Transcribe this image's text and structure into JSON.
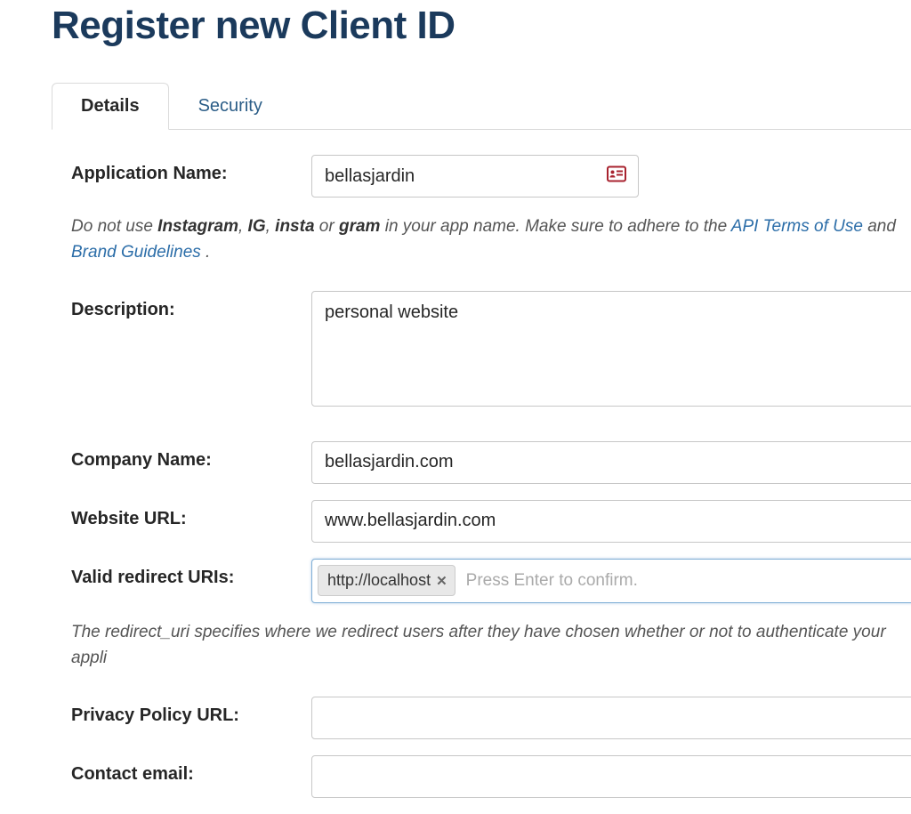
{
  "page_title": "Register new Client ID",
  "tabs": {
    "details": "Details",
    "security": "Security"
  },
  "labels": {
    "application_name": "Application Name:",
    "description": "Description:",
    "company_name": "Company Name:",
    "website_url": "Website URL:",
    "valid_redirect_uris": "Valid redirect URIs:",
    "privacy_policy_url": "Privacy Policy URL:",
    "contact_email": "Contact email:"
  },
  "values": {
    "application_name": "bellasjardin",
    "description": "personal website",
    "company_name": "bellasjardin.com",
    "website_url": "www.bellasjardin.com",
    "redirect_uri_tag": "http://localhost",
    "privacy_policy_url": "",
    "contact_email": ""
  },
  "placeholders": {
    "redirect_uris": "Press Enter to confirm."
  },
  "help": {
    "app_name_prefix": "Do not use ",
    "app_name_bold1": "Instagram",
    "app_name_sep1": ", ",
    "app_name_bold2": "IG",
    "app_name_sep2": ", ",
    "app_name_bold3": "insta",
    "app_name_sep3": " or ",
    "app_name_bold4": "gram",
    "app_name_mid": " in your app name. Make sure to adhere to the ",
    "app_name_link1": "API Terms of Use",
    "app_name_and": " and ",
    "app_name_link2": "Brand Guidelines",
    "app_name_end": " .",
    "redirect_uri": "The redirect_uri specifies where we redirect users after they have chosen whether or not to authenticate your appli"
  }
}
